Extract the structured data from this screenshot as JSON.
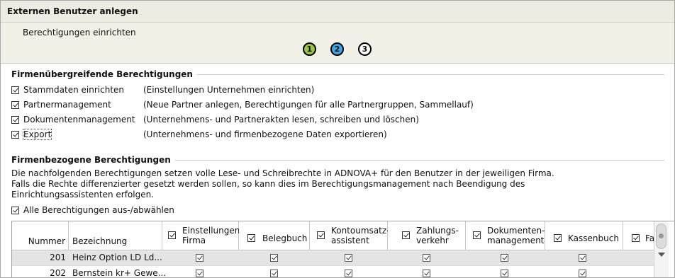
{
  "window": {
    "title": "Externen Benutzer anlegen"
  },
  "wizard": {
    "subtitle": "Berechtigungen einrichten",
    "steps": [
      {
        "label": "1",
        "color": "#9cc43c"
      },
      {
        "label": "2",
        "color": "#3fa6e6"
      },
      {
        "label": "3",
        "color": "#ffffff"
      }
    ],
    "current_step": 2
  },
  "global": {
    "title": "Firmenübergreifende Berechtigungen",
    "items": [
      {
        "label": "Stammdaten einrichten",
        "desc": "(Einstellungen Unternehmen einrichten)",
        "checked": true
      },
      {
        "label": "Partnermanagement",
        "desc": "(Neue Partner anlegen, Berechtigungen für alle Partnergruppen, Sammellauf)",
        "checked": true
      },
      {
        "label": "Dokumentenmanagement",
        "desc": "(Unternehmens- und Partnerakten lesen, schreiben und löschen)",
        "checked": true
      },
      {
        "label": "Export",
        "desc": "(Unternehmens- und firmenbezogene Daten exportieren)",
        "checked": true
      }
    ]
  },
  "company": {
    "title": "Firmenbezogene Berechtigungen",
    "info": [
      "Die nachfolgenden Berechtigungen setzen volle Lese- und Schreibrechte in ADNOVA+ für den Benutzer in der jeweiligen Firma.",
      "Falls die Rechte differenzierter gesetzt werden sollen, so kann dies im Berechtigungsmanagement nach Beendigung des",
      "Einrichtungsassistenten erfolgen."
    ],
    "select_all": {
      "label": "Alle Berechtigungen aus-/abwählen",
      "checked": true
    }
  },
  "table": {
    "columns": {
      "nummer": "Nummer",
      "bezeichnung": "Bezeichnung",
      "einstellungen": [
        "Einstellungen",
        "Firma"
      ],
      "belegbuch": "Belegbuch",
      "kontoumsatz": [
        "Kontoumsatz-",
        "assistent"
      ],
      "zahlung": [
        "Zahlungs-",
        "verkehr"
      ],
      "dokumente": [
        "Dokumenten-",
        "management"
      ],
      "kassenbuch": "Kassenbuch",
      "fa": "Fa"
    },
    "rows": [
      {
        "nummer": "201",
        "bezeichnung": "Heinz Option LD Ld...",
        "selected": true,
        "checks": [
          true,
          true,
          true,
          true,
          true,
          true
        ]
      },
      {
        "nummer": "202",
        "bezeichnung": "Bernstein kr+ Gewe...",
        "selected": false,
        "checks": [
          true,
          true,
          true,
          true,
          true,
          true
        ]
      }
    ]
  }
}
